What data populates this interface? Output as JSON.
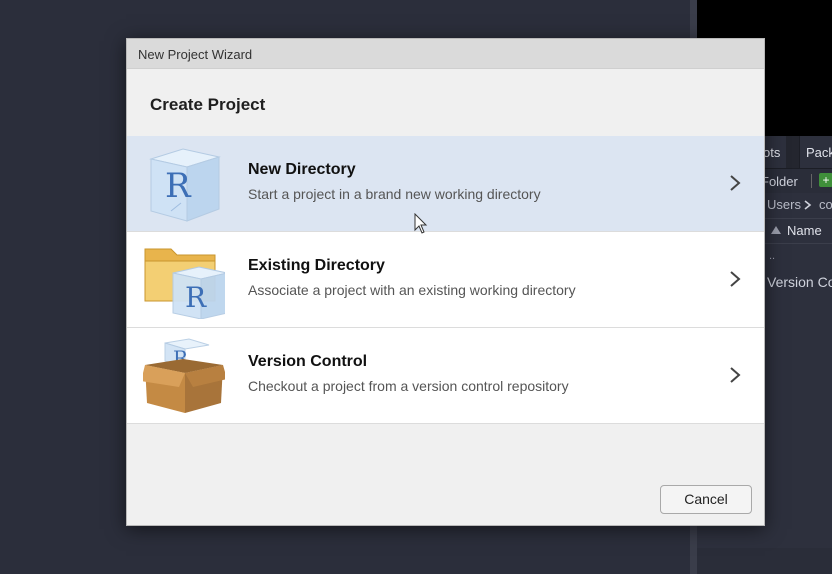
{
  "background": {
    "tabs": [
      "ots",
      "Pack"
    ],
    "toolbar_label": "Folder",
    "breadcrumb": [
      "Users",
      "co"
    ],
    "column_header": "Name",
    "file_rows": [
      "..",
      "Version Co"
    ]
  },
  "dialog": {
    "title": "New Project Wizard",
    "heading": "Create Project",
    "options": [
      {
        "label": "New Directory",
        "description": "Start a project in a brand new working directory",
        "icon": "r-cube-icon",
        "selected": true
      },
      {
        "label": "Existing Directory",
        "description": "Associate a project with an existing working directory",
        "icon": "folder-r-icon",
        "selected": false
      },
      {
        "label": "Version Control",
        "description": "Checkout a project from a version control repository",
        "icon": "box-r-icon",
        "selected": false
      }
    ],
    "cancel_label": "Cancel"
  },
  "colors": {
    "selected_row": "#dce5f2",
    "ide_background": "#2b2e3b",
    "r_blue": "#3d6fb6"
  }
}
